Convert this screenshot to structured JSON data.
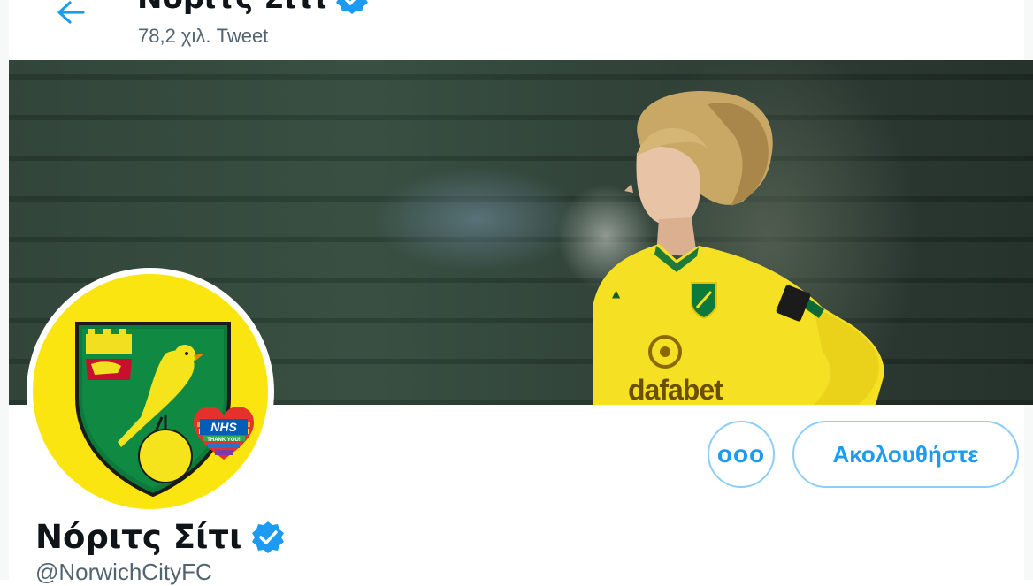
{
  "header": {
    "title": "Νόριτς Σίτι",
    "tweet_count": "78,2 χιλ. Tweet"
  },
  "banner": {
    "sponsor_text": "dafabet"
  },
  "profile": {
    "display_name": "Νόριτς Σίτι",
    "handle": "@NorwichCityFC",
    "verified": true,
    "avatar_badge_top": "NHS",
    "avatar_badge_bottom": "THANK YOU!"
  },
  "actions": {
    "more_label": "ooo",
    "follow_label": "Ακολουθήστε"
  },
  "icons": {
    "back": "arrow-left-icon",
    "verified": "verified-badge-icon"
  },
  "colors": {
    "accent": "#1d9bf0",
    "club_yellow": "#fbe511",
    "club_green": "#00a650"
  }
}
